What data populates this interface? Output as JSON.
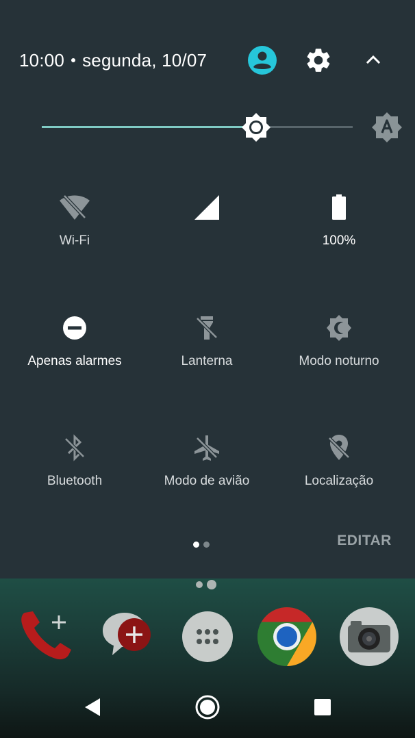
{
  "status": {
    "time": "10:00",
    "date": "segunda, 10/07"
  },
  "header": {
    "icons": [
      "user-icon",
      "settings-gear-icon",
      "collapse-chevron-up-icon"
    ]
  },
  "brightness": {
    "level_fraction": 0.69,
    "auto_icon": "auto-brightness-icon",
    "colors": {
      "fill": "#80cbc4",
      "track": "#58656b"
    }
  },
  "tiles": [
    {
      "key": "wifi",
      "label": "Wi-Fi",
      "icon": "wifi-off-icon",
      "active": false
    },
    {
      "key": "mobile",
      "label": "",
      "icon": "cell-signal-icon",
      "active": true
    },
    {
      "key": "battery",
      "label": "100%",
      "icon": "battery-icon",
      "active": true
    },
    {
      "key": "dnd",
      "label": "Apenas alarmes",
      "icon": "do-not-disturb-icon",
      "active": true
    },
    {
      "key": "flashlight",
      "label": "Lanterna",
      "icon": "flashlight-off-icon",
      "active": false
    },
    {
      "key": "night",
      "label": "Modo noturno",
      "icon": "night-mode-icon",
      "active": false
    },
    {
      "key": "bluetooth",
      "label": "Bluetooth",
      "icon": "bluetooth-off-icon",
      "active": false
    },
    {
      "key": "airplane",
      "label": "Modo de avião",
      "icon": "airplane-off-icon",
      "active": false
    },
    {
      "key": "location",
      "label": "Localização",
      "icon": "location-off-icon",
      "active": false
    }
  ],
  "footer": {
    "edit_label": "EDITAR",
    "pages": 2,
    "current_page": 1
  },
  "dock": {
    "apps": [
      "phone-icon",
      "messages-icon",
      "app-drawer-icon",
      "chrome-icon",
      "camera-icon"
    ]
  },
  "navbar": {
    "buttons": [
      "back-icon",
      "home-icon",
      "recents-icon"
    ]
  }
}
